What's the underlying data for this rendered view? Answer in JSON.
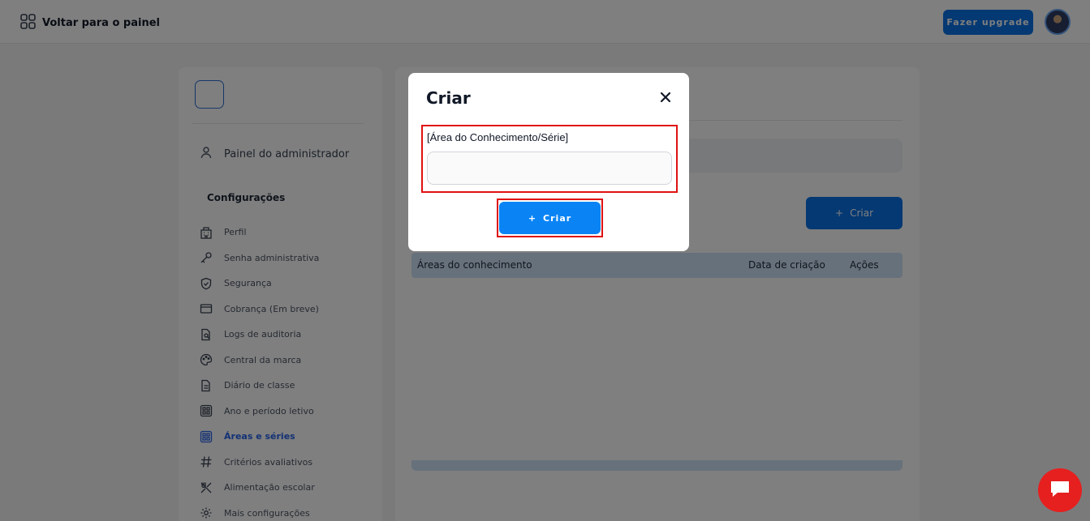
{
  "header": {
    "back_label": "Voltar para o painel",
    "upgrade_label": "Fazer upgrade"
  },
  "sidebar": {
    "admin_label": "Painel do administrador",
    "section_title": "Configurações",
    "items": [
      {
        "label": "Perfil",
        "icon": "building-icon"
      },
      {
        "label": "Senha administrativa",
        "icon": "key-icon"
      },
      {
        "label": "Segurança",
        "icon": "shield-icon"
      },
      {
        "label": "Cobrança (Em breve)",
        "icon": "card-icon"
      },
      {
        "label": "Logs de auditoria",
        "icon": "document-search-icon"
      },
      {
        "label": "Central da marca",
        "icon": "palette-icon"
      },
      {
        "label": "Diário de classe",
        "icon": "document-icon"
      },
      {
        "label": "Ano e período letivo",
        "icon": "grid-icon"
      },
      {
        "label": "Áreas e séries",
        "icon": "grid-icon",
        "active": true
      },
      {
        "label": "Critérios avaliativos",
        "icon": "hash-icon"
      },
      {
        "label": "Alimentação escolar",
        "icon": "utensils-icon"
      },
      {
        "label": "Mais configurações",
        "icon": "gear-icon"
      }
    ]
  },
  "main": {
    "create_label": "Criar",
    "table": {
      "columns": [
        "Áreas do conhecimento",
        "Data de criação",
        "Ações"
      ]
    }
  },
  "modal": {
    "title": "Criar",
    "field_label": "[Área do Conhecimento/Série]",
    "field_value": "",
    "create_label": "Criar"
  },
  "colors": {
    "accent": "#0a84f5",
    "highlight": "#e01212",
    "chat": "#e5201f"
  }
}
